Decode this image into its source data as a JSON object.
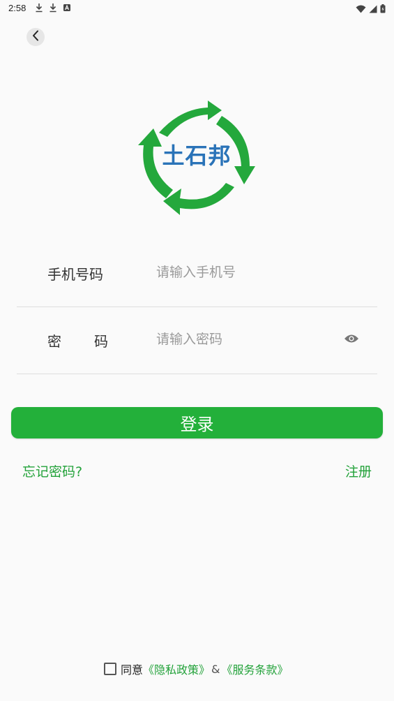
{
  "status_bar": {
    "time": "2:58",
    "left_icons": [
      "download-icon",
      "download-icon",
      "a-badge-icon"
    ],
    "right_icons": [
      "wifi-icon",
      "signal-icon",
      "battery-icon"
    ]
  },
  "header": {
    "back_icon": "chevron-left-icon"
  },
  "logo": {
    "text": "土石邦",
    "ring_color": "#24a83c",
    "text_color": "#2a73b8"
  },
  "form": {
    "phone": {
      "label": "手机号码",
      "value": "",
      "placeholder": "请输入手机号"
    },
    "password": {
      "label_first": "密",
      "label_second": "码",
      "value": "",
      "placeholder": "请输入密码",
      "toggle_icon": "eye-icon"
    }
  },
  "actions": {
    "login_label": "登录",
    "forgot_label": "忘记密码?",
    "register_label": "注册"
  },
  "agreement": {
    "checked": false,
    "prefix": "同意",
    "privacy_label": "《隐私政策》",
    "separator": "&",
    "terms_label": "《服务条款》"
  },
  "colors": {
    "accent": "#23b03a",
    "link": "#23a23a",
    "background": "#fafafa"
  }
}
